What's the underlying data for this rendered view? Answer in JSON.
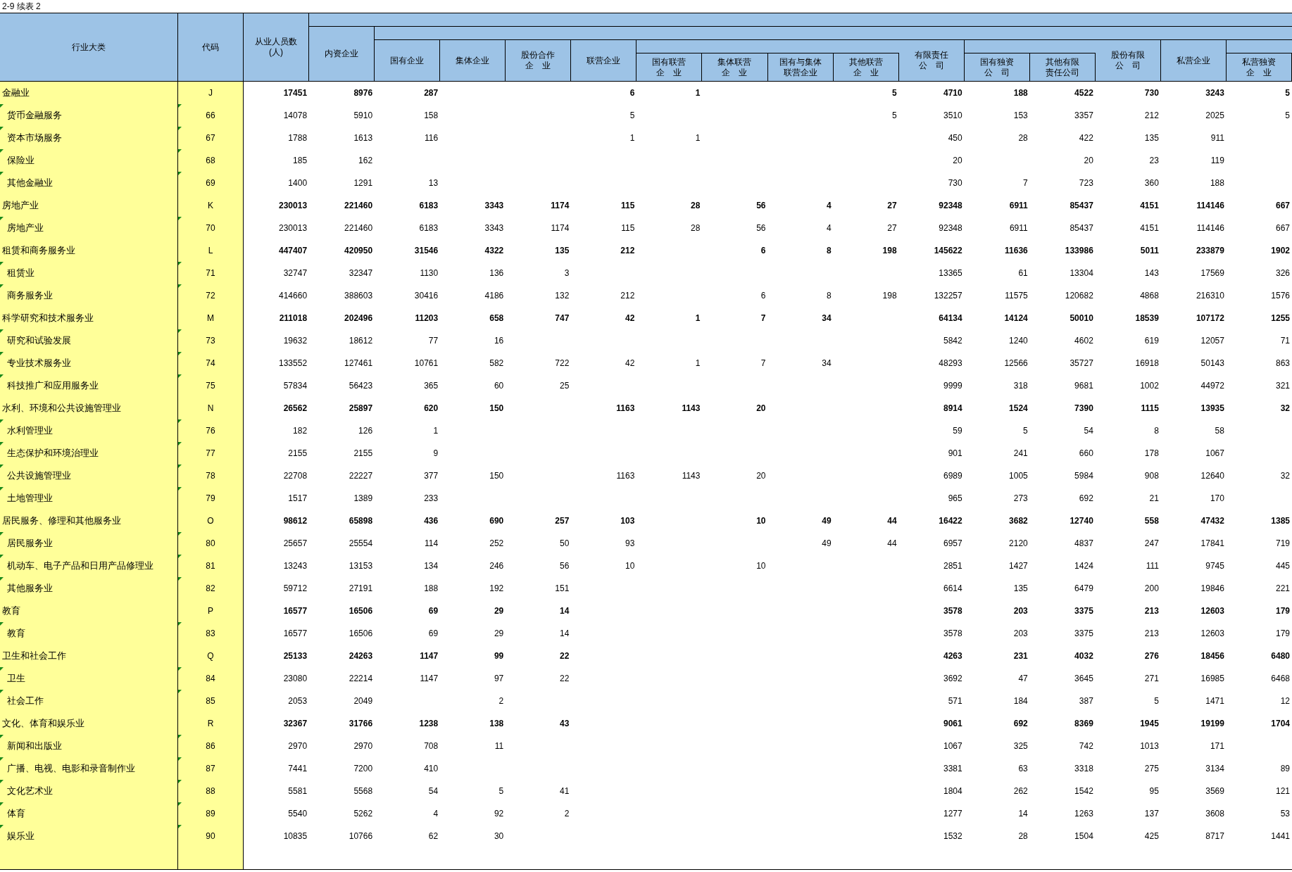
{
  "title": "2-9  续表 2",
  "header": {
    "name_col": "行业大类",
    "code_col": "代码",
    "columns": [
      {
        "lines": [
          "从业人员数",
          "(人)"
        ],
        "children": [
          {
            "lines": [
              "内资企业"
            ],
            "children": [
              {
                "lines": [
                  "国有企业"
                ]
              },
              {
                "lines": [
                  "集体企业"
                ]
              },
              {
                "lines": [
                  "股份合作",
                  "企　业"
                ]
              },
              {
                "lines": [
                  "联营企业"
                ],
                "children": [
                  {
                    "lines": [
                      "国有联营",
                      "企　业"
                    ]
                  },
                  {
                    "lines": [
                      "集体联营",
                      "企　业"
                    ]
                  },
                  {
                    "lines": [
                      "国有与集体",
                      "联营企业"
                    ]
                  },
                  {
                    "lines": [
                      "其他联营",
                      "企　业"
                    ]
                  }
                ]
              },
              {
                "lines": [
                  "有限责任",
                  "公　司"
                ],
                "children": [
                  {
                    "lines": [
                      "国有独资",
                      "公　司"
                    ]
                  },
                  {
                    "lines": [
                      "其他有限",
                      "责任公司"
                    ]
                  }
                ]
              },
              {
                "lines": [
                  "股份有限",
                  "公　司"
                ]
              },
              {
                "lines": [
                  "私营企业"
                ],
                "children": [
                  {
                    "lines": [
                      "私营独资",
                      "企　业"
                    ]
                  }
                ]
              }
            ]
          }
        ]
      }
    ]
  },
  "rows": [
    {
      "kind": "category",
      "name": "金融业",
      "code": "J",
      "cells": [
        "17451",
        "8976",
        "287",
        null,
        null,
        "6",
        "1",
        null,
        null,
        "5",
        "4710",
        "188",
        "4522",
        "730",
        "3243",
        "5"
      ]
    },
    {
      "kind": "item",
      "name": "货币金融服务",
      "code": "66",
      "cells": [
        "14078",
        "5910",
        "158",
        null,
        null,
        "5",
        null,
        null,
        null,
        "5",
        "3510",
        "153",
        "3357",
        "212",
        "2025",
        "5"
      ]
    },
    {
      "kind": "item",
      "name": "资本市场服务",
      "code": "67",
      "cells": [
        "1788",
        "1613",
        "116",
        null,
        null,
        "1",
        "1",
        null,
        null,
        null,
        "450",
        "28",
        "422",
        "135",
        "911",
        null
      ]
    },
    {
      "kind": "item",
      "name": "保险业",
      "code": "68",
      "cells": [
        "185",
        "162",
        null,
        null,
        null,
        null,
        null,
        null,
        null,
        null,
        "20",
        null,
        "20",
        "23",
        "119",
        null
      ]
    },
    {
      "kind": "item",
      "name": "其他金融业",
      "code": "69",
      "cells": [
        "1400",
        "1291",
        "13",
        null,
        null,
        null,
        null,
        null,
        null,
        null,
        "730",
        "7",
        "723",
        "360",
        "188",
        null
      ]
    },
    {
      "kind": "category",
      "name": "房地产业",
      "code": "K",
      "cells": [
        "230013",
        "221460",
        "6183",
        "3343",
        "1174",
        "115",
        "28",
        "56",
        "4",
        "27",
        "92348",
        "6911",
        "85437",
        "4151",
        "114146",
        "667"
      ]
    },
    {
      "kind": "item",
      "name": "房地产业",
      "code": "70",
      "cells": [
        "230013",
        "221460",
        "6183",
        "3343",
        "1174",
        "115",
        "28",
        "56",
        "4",
        "27",
        "92348",
        "6911",
        "85437",
        "4151",
        "114146",
        "667"
      ]
    },
    {
      "kind": "category",
      "name": "租赁和商务服务业",
      "code": "L",
      "cells": [
        "447407",
        "420950",
        "31546",
        "4322",
        "135",
        "212",
        null,
        "6",
        "8",
        "198",
        "145622",
        "11636",
        "133986",
        "5011",
        "233879",
        "1902"
      ]
    },
    {
      "kind": "item",
      "name": "租赁业",
      "code": "71",
      "cells": [
        "32747",
        "32347",
        "1130",
        "136",
        "3",
        null,
        null,
        null,
        null,
        null,
        "13365",
        "61",
        "13304",
        "143",
        "17569",
        "326"
      ]
    },
    {
      "kind": "item",
      "name": "商务服务业",
      "code": "72",
      "cells": [
        "414660",
        "388603",
        "30416",
        "4186",
        "132",
        "212",
        null,
        "6",
        "8",
        "198",
        "132257",
        "11575",
        "120682",
        "4868",
        "216310",
        "1576"
      ]
    },
    {
      "kind": "category",
      "name": "科学研究和技术服务业",
      "code": "M",
      "cells": [
        "211018",
        "202496",
        "11203",
        "658",
        "747",
        "42",
        "1",
        "7",
        "34",
        null,
        "64134",
        "14124",
        "50010",
        "18539",
        "107172",
        "1255"
      ]
    },
    {
      "kind": "item",
      "name": "研究和试验发展",
      "code": "73",
      "cells": [
        "19632",
        "18612",
        "77",
        "16",
        null,
        null,
        null,
        null,
        null,
        null,
        "5842",
        "1240",
        "4602",
        "619",
        "12057",
        "71"
      ]
    },
    {
      "kind": "item",
      "name": "专业技术服务业",
      "code": "74",
      "cells": [
        "133552",
        "127461",
        "10761",
        "582",
        "722",
        "42",
        "1",
        "7",
        "34",
        null,
        "48293",
        "12566",
        "35727",
        "16918",
        "50143",
        "863"
      ]
    },
    {
      "kind": "item",
      "name": "科技推广和应用服务业",
      "code": "75",
      "cells": [
        "57834",
        "56423",
        "365",
        "60",
        "25",
        null,
        null,
        null,
        null,
        null,
        "9999",
        "318",
        "9681",
        "1002",
        "44972",
        "321"
      ]
    },
    {
      "kind": "category",
      "name": "水利、环境和公共设施管理业",
      "code": "N",
      "cells": [
        "26562",
        "25897",
        "620",
        "150",
        null,
        "1163",
        "1143",
        "20",
        null,
        null,
        "8914",
        "1524",
        "7390",
        "1115",
        "13935",
        "32"
      ]
    },
    {
      "kind": "item",
      "name": "水利管理业",
      "code": "76",
      "cells": [
        "182",
        "126",
        "1",
        null,
        null,
        null,
        null,
        null,
        null,
        null,
        "59",
        "5",
        "54",
        "8",
        "58",
        null
      ]
    },
    {
      "kind": "item",
      "name": "生态保护和环境治理业",
      "code": "77",
      "cells": [
        "2155",
        "2155",
        "9",
        null,
        null,
        null,
        null,
        null,
        null,
        null,
        "901",
        "241",
        "660",
        "178",
        "1067",
        null
      ]
    },
    {
      "kind": "item",
      "name": "公共设施管理业",
      "code": "78",
      "cells": [
        "22708",
        "22227",
        "377",
        "150",
        null,
        "1163",
        "1143",
        "20",
        null,
        null,
        "6989",
        "1005",
        "5984",
        "908",
        "12640",
        "32"
      ]
    },
    {
      "kind": "item",
      "name": "土地管理业",
      "code": "79",
      "cells": [
        "1517",
        "1389",
        "233",
        null,
        null,
        null,
        null,
        null,
        null,
        null,
        "965",
        "273",
        "692",
        "21",
        "170",
        null
      ]
    },
    {
      "kind": "category",
      "name": "居民服务、修理和其他服务业",
      "code": "O",
      "cells": [
        "98612",
        "65898",
        "436",
        "690",
        "257",
        "103",
        null,
        "10",
        "49",
        "44",
        "16422",
        "3682",
        "12740",
        "558",
        "47432",
        "1385"
      ]
    },
    {
      "kind": "item",
      "name": "居民服务业",
      "code": "80",
      "cells": [
        "25657",
        "25554",
        "114",
        "252",
        "50",
        "93",
        null,
        null,
        "49",
        "44",
        "6957",
        "2120",
        "4837",
        "247",
        "17841",
        "719"
      ]
    },
    {
      "kind": "item",
      "name": "机动车、电子产品和日用产品修理业",
      "code": "81",
      "cells": [
        "13243",
        "13153",
        "134",
        "246",
        "56",
        "10",
        null,
        "10",
        null,
        null,
        "2851",
        "1427",
        "1424",
        "111",
        "9745",
        "445"
      ]
    },
    {
      "kind": "item",
      "name": "其他服务业",
      "code": "82",
      "cells": [
        "59712",
        "27191",
        "188",
        "192",
        "151",
        null,
        null,
        null,
        null,
        null,
        "6614",
        "135",
        "6479",
        "200",
        "19846",
        "221"
      ]
    },
    {
      "kind": "category",
      "name": "教育",
      "code": "P",
      "cells": [
        "16577",
        "16506",
        "69",
        "29",
        "14",
        null,
        null,
        null,
        null,
        null,
        "3578",
        "203",
        "3375",
        "213",
        "12603",
        "179"
      ]
    },
    {
      "kind": "item",
      "name": "教育",
      "code": "83",
      "cells": [
        "16577",
        "16506",
        "69",
        "29",
        "14",
        null,
        null,
        null,
        null,
        null,
        "3578",
        "203",
        "3375",
        "213",
        "12603",
        "179"
      ]
    },
    {
      "kind": "category",
      "name": "卫生和社会工作",
      "code": "Q",
      "cells": [
        "25133",
        "24263",
        "1147",
        "99",
        "22",
        null,
        null,
        null,
        null,
        null,
        "4263",
        "231",
        "4032",
        "276",
        "18456",
        "6480"
      ]
    },
    {
      "kind": "item",
      "name": "卫生",
      "code": "84",
      "cells": [
        "23080",
        "22214",
        "1147",
        "97",
        "22",
        null,
        null,
        null,
        null,
        null,
        "3692",
        "47",
        "3645",
        "271",
        "16985",
        "6468"
      ]
    },
    {
      "kind": "item",
      "name": "社会工作",
      "code": "85",
      "cells": [
        "2053",
        "2049",
        null,
        "2",
        null,
        null,
        null,
        null,
        null,
        null,
        "571",
        "184",
        "387",
        "5",
        "1471",
        "12"
      ]
    },
    {
      "kind": "category",
      "name": "文化、体育和娱乐业",
      "code": "R",
      "cells": [
        "32367",
        "31766",
        "1238",
        "138",
        "43",
        null,
        null,
        null,
        null,
        null,
        "9061",
        "692",
        "8369",
        "1945",
        "19199",
        "1704"
      ]
    },
    {
      "kind": "item",
      "name": "新闻和出版业",
      "code": "86",
      "cells": [
        "2970",
        "2970",
        "708",
        "11",
        null,
        null,
        null,
        null,
        null,
        null,
        "1067",
        "325",
        "742",
        "1013",
        "171",
        null
      ]
    },
    {
      "kind": "item",
      "name": "广播、电视、电影和录音制作业",
      "code": "87",
      "cells": [
        "7441",
        "7200",
        "410",
        null,
        null,
        null,
        null,
        null,
        null,
        null,
        "3381",
        "63",
        "3318",
        "275",
        "3134",
        "89"
      ]
    },
    {
      "kind": "item",
      "name": "文化艺术业",
      "code": "88",
      "cells": [
        "5581",
        "5568",
        "54",
        "5",
        "41",
        null,
        null,
        null,
        null,
        null,
        "1804",
        "262",
        "1542",
        "95",
        "3569",
        "121"
      ]
    },
    {
      "kind": "item",
      "name": "体育",
      "code": "89",
      "cells": [
        "5540",
        "5262",
        "4",
        "92",
        "2",
        null,
        null,
        null,
        null,
        null,
        "1277",
        "14",
        "1263",
        "137",
        "3608",
        "53"
      ]
    },
    {
      "kind": "item",
      "name": "娱乐业",
      "code": "90",
      "cells": [
        "10835",
        "10766",
        "62",
        "30",
        null,
        null,
        null,
        null,
        null,
        null,
        "1532",
        "28",
        "1504",
        "425",
        "8717",
        "1441"
      ]
    }
  ]
}
